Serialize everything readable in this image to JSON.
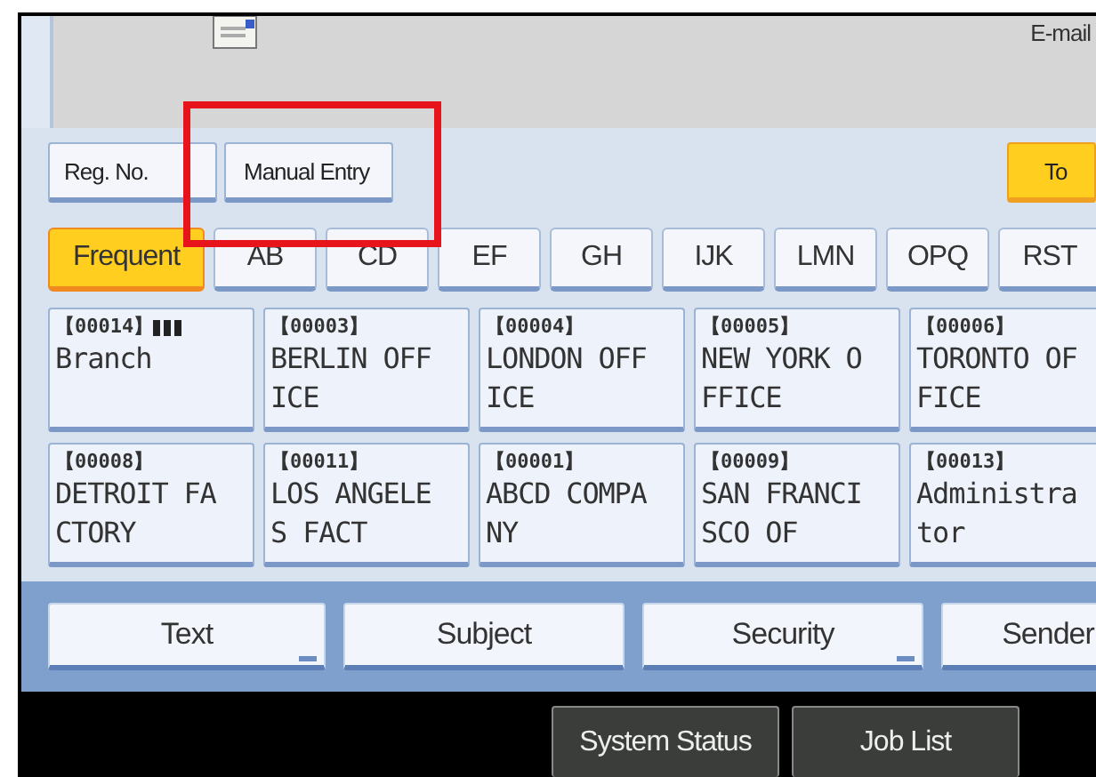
{
  "header": {
    "label": "E-mail"
  },
  "entry_buttons": [
    {
      "label": "Reg. No."
    },
    {
      "label": "Manual Entry"
    }
  ],
  "destination_button": {
    "label": "To",
    "selected": true
  },
  "highlight": {
    "shown": true
  },
  "tabs": [
    {
      "label": "Frequent",
      "selected": true
    },
    {
      "label": "AB",
      "selected": false
    },
    {
      "label": "CD",
      "selected": false
    },
    {
      "label": "EF",
      "selected": false
    },
    {
      "label": "GH",
      "selected": false
    },
    {
      "label": "IJK",
      "selected": false
    },
    {
      "label": "LMN",
      "selected": false
    },
    {
      "label": "OPQ",
      "selected": false
    },
    {
      "label": "RST",
      "selected": false
    }
  ],
  "destinations": [
    {
      "number": "【00014】",
      "group": true,
      "lines": [
        "Branch"
      ]
    },
    {
      "number": "【00003】",
      "group": false,
      "lines": [
        "BERLIN OFF",
        "ICE"
      ]
    },
    {
      "number": "【00004】",
      "group": false,
      "lines": [
        "LONDON OFF",
        "ICE"
      ]
    },
    {
      "number": "【00005】",
      "group": false,
      "lines": [
        "NEW YORK O",
        "FFICE"
      ]
    },
    {
      "number": "【00006】",
      "group": false,
      "lines": [
        "TORONTO OF",
        "FICE"
      ]
    },
    {
      "number": "【00008】",
      "group": false,
      "lines": [
        "DETROIT FA",
        "CTORY"
      ]
    },
    {
      "number": "【00011】",
      "group": false,
      "lines": [
        "LOS ANGELE",
        "S FACT"
      ]
    },
    {
      "number": "【00001】",
      "group": false,
      "lines": [
        "ABCD COMPA",
        "NY"
      ]
    },
    {
      "number": "【00009】",
      "group": false,
      "lines": [
        "SAN FRANCI",
        "SCO OF"
      ]
    },
    {
      "number": "【00013】",
      "group": false,
      "lines": [
        "Administra",
        "tor"
      ]
    }
  ],
  "options": [
    {
      "label": "Text",
      "more": true
    },
    {
      "label": "Subject",
      "more": false
    },
    {
      "label": "Security",
      "more": true
    },
    {
      "label": "Sender"
    }
  ],
  "status_bar": [
    {
      "label": "System Status"
    },
    {
      "label": "Job List"
    }
  ]
}
